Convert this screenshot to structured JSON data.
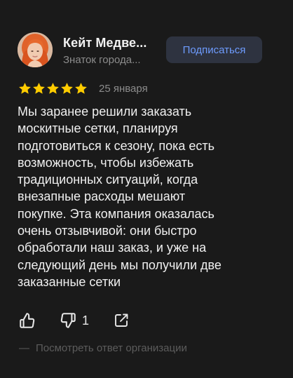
{
  "author": {
    "name": "Кейт Медве...",
    "status": "Знаток города..."
  },
  "subscribe_label": "Подписаться",
  "rating": {
    "stars": 5,
    "max": 5,
    "date": "25 января"
  },
  "review_lines": [
    "Мы заранее решили заказать",
    "москитные сетки, планируя",
    "подготовиться к сезону, пока есть",
    "возможность, чтобы избежать",
    "традиционных ситуаций, когда",
    "внезапные расходы мешают",
    "покупке. Эта компания оказалась",
    "очень отзывчивой: они быстро",
    "обработали наш заказ, и уже на",
    "следующий день мы получили две",
    "заказанные сетки"
  ],
  "actions": {
    "like_icon": "thumbs-up-icon",
    "dislike_icon": "thumbs-down-icon",
    "dislike_count": "1",
    "share_icon": "share-icon"
  },
  "org_reply": {
    "dash": "—",
    "label": "Посмотреть ответ организации"
  },
  "colors": {
    "background": "#1a1a1a",
    "star": "#ffcc00",
    "button_bg": "#2e3340",
    "button_text": "#6e9cff",
    "muted_text": "#8c8c8c"
  }
}
